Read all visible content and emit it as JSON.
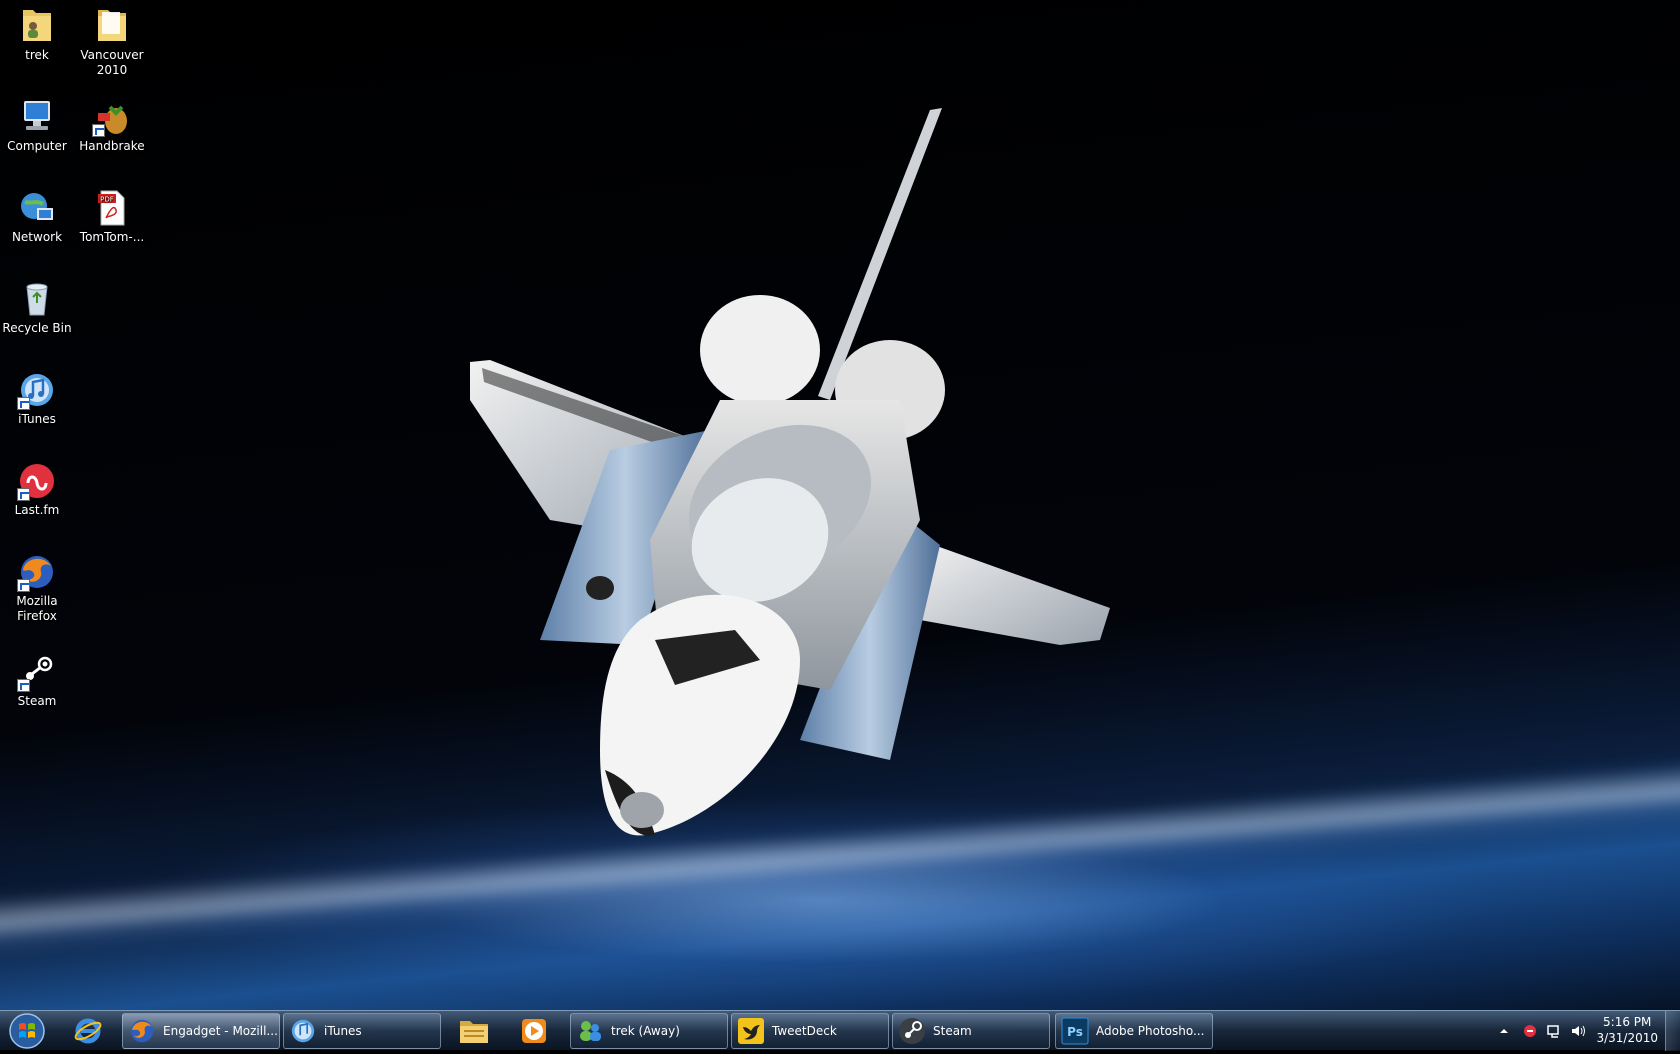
{
  "desktop": {
    "icons": [
      {
        "id": "trek",
        "label": "trek",
        "icon": "user-folder-icon"
      },
      {
        "id": "vancouver",
        "label": "Vancouver 2010",
        "icon": "folder-icon"
      },
      {
        "id": "computer",
        "label": "Computer",
        "icon": "computer-icon"
      },
      {
        "id": "handbrake",
        "label": "Handbrake",
        "icon": "handbrake-icon"
      },
      {
        "id": "network",
        "label": "Network",
        "icon": "network-icon"
      },
      {
        "id": "tomtom",
        "label": "TomTom-...",
        "icon": "pdf-icon",
        "badge": "PDF"
      },
      {
        "id": "recycle",
        "label": "Recycle Bin",
        "icon": "recycle-bin-icon"
      },
      {
        "id": "itunes",
        "label": "iTunes",
        "icon": "itunes-icon"
      },
      {
        "id": "lastfm",
        "label": "Last.fm",
        "icon": "lastfm-icon"
      },
      {
        "id": "firefox",
        "label": "Mozilla Firefox",
        "icon": "firefox-icon"
      },
      {
        "id": "steam",
        "label": "Steam",
        "icon": "steam-icon"
      }
    ]
  },
  "taskbar": {
    "start": {
      "icon": "windows-start-icon"
    },
    "pinned": [
      {
        "id": "ie",
        "icon": "internet-explorer-icon"
      },
      {
        "id": "explorer",
        "icon": "folder-icon"
      },
      {
        "id": "media",
        "icon": "media-player-icon"
      }
    ],
    "tasks": [
      {
        "id": "engadget",
        "label": "Engadget - Mozill...",
        "icon": "firefox-icon",
        "active": true
      },
      {
        "id": "itunes",
        "label": "iTunes",
        "icon": "itunes-icon",
        "active": false
      },
      {
        "id": "trek",
        "label": "trek (Away)",
        "icon": "messenger-icon",
        "active": false
      },
      {
        "id": "tweetdeck",
        "label": "TweetDeck",
        "icon": "tweetdeck-icon",
        "active": false
      },
      {
        "id": "steam",
        "label": "Steam",
        "icon": "steam-icon",
        "active": false
      },
      {
        "id": "photoshop",
        "label": "Adobe Photosho...",
        "icon": "photoshop-icon",
        "badge": "Ps",
        "active": false
      }
    ],
    "tray": {
      "icons": [
        "show-hidden-icons-arrow",
        "tray-app-icon",
        "action-center-icon",
        "network-tray-icon",
        "volume-icon"
      ],
      "time": "5:16 PM",
      "date": "3/31/2010"
    }
  }
}
